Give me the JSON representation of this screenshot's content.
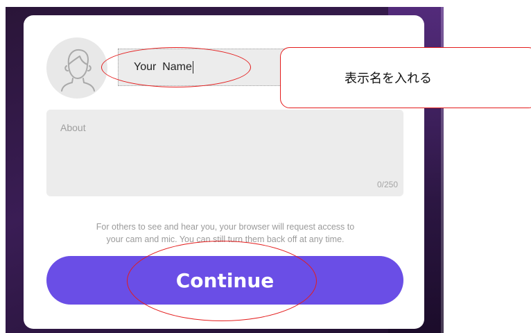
{
  "profile_form": {
    "name_value": "Your  Name",
    "about_placeholder": "About",
    "about_counter": "0/250",
    "notice_line1": "For others to see and hear you, your browser will request access to",
    "notice_line2": "your cam and mic. You can still turn them back off at any time.",
    "continue_label": "Continue"
  },
  "annotation": {
    "callout_text": "表示名を入れる"
  },
  "icons": {
    "avatar": "person-icon"
  },
  "colors": {
    "accent": "#6a4ee6",
    "marker": "#e41c1c",
    "field_bg": "#ececec"
  }
}
